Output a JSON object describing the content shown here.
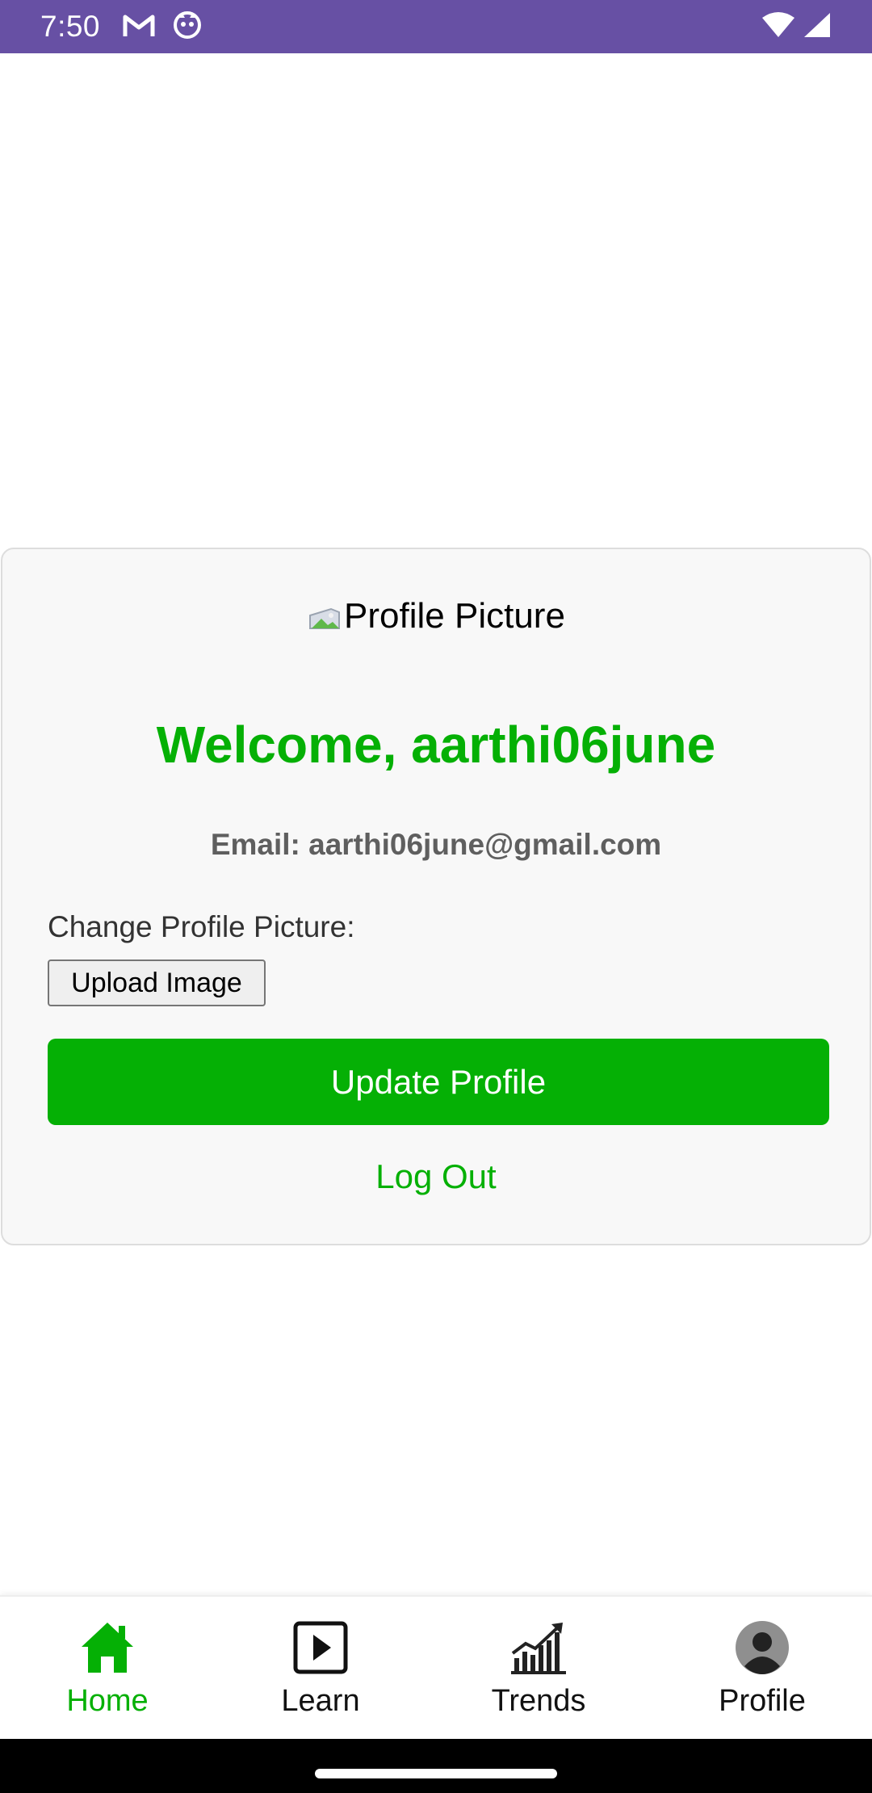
{
  "status_bar": {
    "time": "7:50",
    "bg_color": "#6750a4",
    "left_icons": [
      "gmail-icon",
      "app-notification-icon"
    ],
    "right_icons": [
      "wifi-icon",
      "cellular-signal-icon"
    ]
  },
  "profile_card": {
    "profile_picture_alt": "Profile Picture",
    "welcome_text": "Welcome, aarthi06june",
    "email_text": "Email: aarthi06june@gmail.com",
    "change_picture_label": "Change Profile Picture:",
    "upload_button_label": "Upload Image",
    "update_button_label": "Update Profile",
    "logout_label": "Log Out",
    "accent_color": "#05b005"
  },
  "bottom_nav": {
    "items": [
      {
        "label": "Home",
        "icon": "home-icon",
        "active": true
      },
      {
        "label": "Learn",
        "icon": "play-icon",
        "active": false
      },
      {
        "label": "Trends",
        "icon": "trend-chart-icon",
        "active": false
      },
      {
        "label": "Profile",
        "icon": "user-avatar-icon",
        "active": false
      }
    ]
  }
}
